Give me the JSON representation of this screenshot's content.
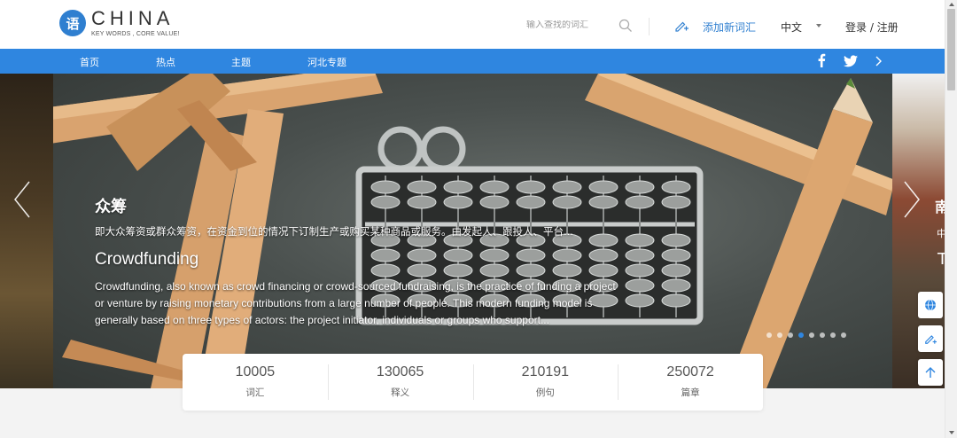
{
  "header": {
    "logo_mark": "语",
    "logo_title": "CHINA",
    "logo_subtitle": "KEY WORDS , CORE VALUE!",
    "search_placeholder": "输入查找的词汇",
    "add_term_label": "添加新词汇",
    "language": "中文",
    "login_label": "登录 / 注册"
  },
  "nav": {
    "items": [
      {
        "label": "首页"
      },
      {
        "label": "热点"
      },
      {
        "label": "主题"
      },
      {
        "label": "河北专题"
      }
    ],
    "social": [
      "facebook-icon",
      "twitter-icon",
      "chevron-right-icon"
    ]
  },
  "slide": {
    "title_cn": "众筹",
    "desc_cn": "即大众筹资或群众筹资，在资金到位的情况下订制生产或购买某种商品或服务。由发起人、跟投人、平台...",
    "title_en": "Crowdfunding",
    "desc_en": "Crowdfunding, also known as crowd financing or crowd-sourced fundraising, is the practice of funding a project or venture by raising monetary contributions from a large number of people. This modern funding model is generally based on three types of actors: the project initiator, individuals or groups who support...",
    "next_peek_title": "南",
    "next_peek_sub": "中",
    "next_peek_en": "T",
    "dot_count": 8,
    "active_dot": 3
  },
  "stats": [
    {
      "value": "10005",
      "label": "词汇"
    },
    {
      "value": "130065",
      "label": "释义"
    },
    {
      "value": "210191",
      "label": "例句"
    },
    {
      "value": "250072",
      "label": "篇章"
    }
  ],
  "side_tools": [
    "globe-icon",
    "edit-icon",
    "arrow-up-icon"
  ],
  "colors": {
    "brand_blue": "#2f86e0",
    "link_blue": "#2f7fd0"
  }
}
